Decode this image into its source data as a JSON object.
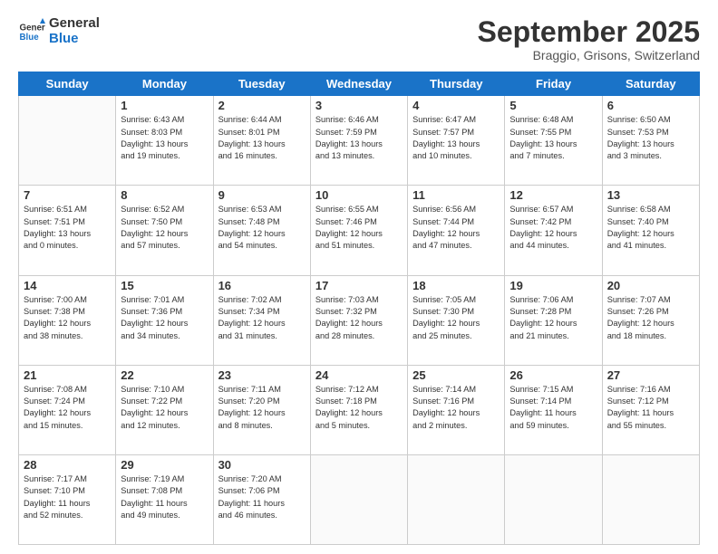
{
  "logo": {
    "line1": "General",
    "line2": "Blue"
  },
  "title": "September 2025",
  "location": "Braggio, Grisons, Switzerland",
  "days_of_week": [
    "Sunday",
    "Monday",
    "Tuesday",
    "Wednesday",
    "Thursday",
    "Friday",
    "Saturday"
  ],
  "weeks": [
    [
      {
        "day": "",
        "info": ""
      },
      {
        "day": "1",
        "info": "Sunrise: 6:43 AM\nSunset: 8:03 PM\nDaylight: 13 hours\nand 19 minutes."
      },
      {
        "day": "2",
        "info": "Sunrise: 6:44 AM\nSunset: 8:01 PM\nDaylight: 13 hours\nand 16 minutes."
      },
      {
        "day": "3",
        "info": "Sunrise: 6:46 AM\nSunset: 7:59 PM\nDaylight: 13 hours\nand 13 minutes."
      },
      {
        "day": "4",
        "info": "Sunrise: 6:47 AM\nSunset: 7:57 PM\nDaylight: 13 hours\nand 10 minutes."
      },
      {
        "day": "5",
        "info": "Sunrise: 6:48 AM\nSunset: 7:55 PM\nDaylight: 13 hours\nand 7 minutes."
      },
      {
        "day": "6",
        "info": "Sunrise: 6:50 AM\nSunset: 7:53 PM\nDaylight: 13 hours\nand 3 minutes."
      }
    ],
    [
      {
        "day": "7",
        "info": "Sunrise: 6:51 AM\nSunset: 7:51 PM\nDaylight: 13 hours\nand 0 minutes."
      },
      {
        "day": "8",
        "info": "Sunrise: 6:52 AM\nSunset: 7:50 PM\nDaylight: 12 hours\nand 57 minutes."
      },
      {
        "day": "9",
        "info": "Sunrise: 6:53 AM\nSunset: 7:48 PM\nDaylight: 12 hours\nand 54 minutes."
      },
      {
        "day": "10",
        "info": "Sunrise: 6:55 AM\nSunset: 7:46 PM\nDaylight: 12 hours\nand 51 minutes."
      },
      {
        "day": "11",
        "info": "Sunrise: 6:56 AM\nSunset: 7:44 PM\nDaylight: 12 hours\nand 47 minutes."
      },
      {
        "day": "12",
        "info": "Sunrise: 6:57 AM\nSunset: 7:42 PM\nDaylight: 12 hours\nand 44 minutes."
      },
      {
        "day": "13",
        "info": "Sunrise: 6:58 AM\nSunset: 7:40 PM\nDaylight: 12 hours\nand 41 minutes."
      }
    ],
    [
      {
        "day": "14",
        "info": "Sunrise: 7:00 AM\nSunset: 7:38 PM\nDaylight: 12 hours\nand 38 minutes."
      },
      {
        "day": "15",
        "info": "Sunrise: 7:01 AM\nSunset: 7:36 PM\nDaylight: 12 hours\nand 34 minutes."
      },
      {
        "day": "16",
        "info": "Sunrise: 7:02 AM\nSunset: 7:34 PM\nDaylight: 12 hours\nand 31 minutes."
      },
      {
        "day": "17",
        "info": "Sunrise: 7:03 AM\nSunset: 7:32 PM\nDaylight: 12 hours\nand 28 minutes."
      },
      {
        "day": "18",
        "info": "Sunrise: 7:05 AM\nSunset: 7:30 PM\nDaylight: 12 hours\nand 25 minutes."
      },
      {
        "day": "19",
        "info": "Sunrise: 7:06 AM\nSunset: 7:28 PM\nDaylight: 12 hours\nand 21 minutes."
      },
      {
        "day": "20",
        "info": "Sunrise: 7:07 AM\nSunset: 7:26 PM\nDaylight: 12 hours\nand 18 minutes."
      }
    ],
    [
      {
        "day": "21",
        "info": "Sunrise: 7:08 AM\nSunset: 7:24 PM\nDaylight: 12 hours\nand 15 minutes."
      },
      {
        "day": "22",
        "info": "Sunrise: 7:10 AM\nSunset: 7:22 PM\nDaylight: 12 hours\nand 12 minutes."
      },
      {
        "day": "23",
        "info": "Sunrise: 7:11 AM\nSunset: 7:20 PM\nDaylight: 12 hours\nand 8 minutes."
      },
      {
        "day": "24",
        "info": "Sunrise: 7:12 AM\nSunset: 7:18 PM\nDaylight: 12 hours\nand 5 minutes."
      },
      {
        "day": "25",
        "info": "Sunrise: 7:14 AM\nSunset: 7:16 PM\nDaylight: 12 hours\nand 2 minutes."
      },
      {
        "day": "26",
        "info": "Sunrise: 7:15 AM\nSunset: 7:14 PM\nDaylight: 11 hours\nand 59 minutes."
      },
      {
        "day": "27",
        "info": "Sunrise: 7:16 AM\nSunset: 7:12 PM\nDaylight: 11 hours\nand 55 minutes."
      }
    ],
    [
      {
        "day": "28",
        "info": "Sunrise: 7:17 AM\nSunset: 7:10 PM\nDaylight: 11 hours\nand 52 minutes."
      },
      {
        "day": "29",
        "info": "Sunrise: 7:19 AM\nSunset: 7:08 PM\nDaylight: 11 hours\nand 49 minutes."
      },
      {
        "day": "30",
        "info": "Sunrise: 7:20 AM\nSunset: 7:06 PM\nDaylight: 11 hours\nand 46 minutes."
      },
      {
        "day": "",
        "info": ""
      },
      {
        "day": "",
        "info": ""
      },
      {
        "day": "",
        "info": ""
      },
      {
        "day": "",
        "info": ""
      }
    ]
  ]
}
